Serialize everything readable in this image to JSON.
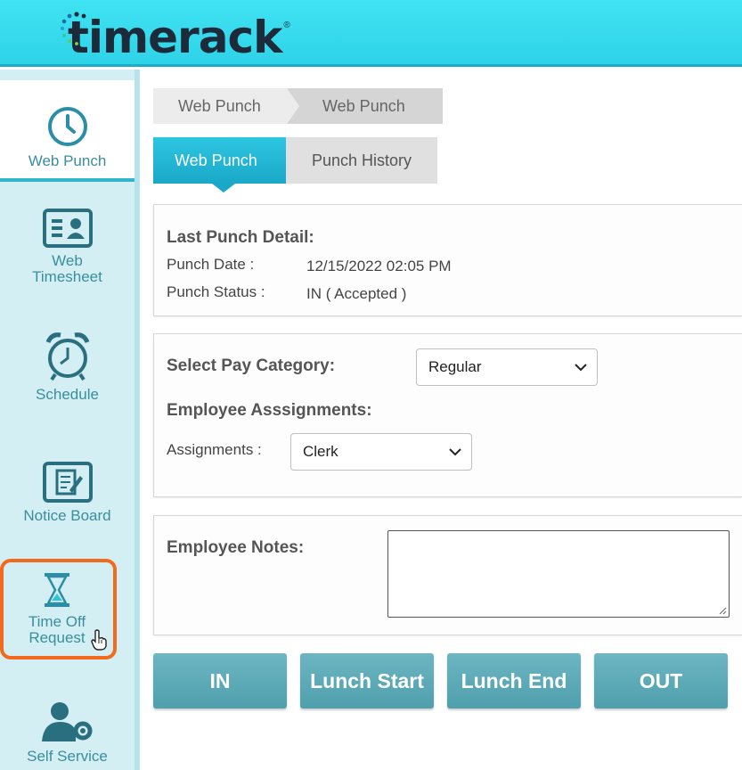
{
  "brand": {
    "name": "timerack",
    "reg": "®"
  },
  "sidebar": {
    "items": [
      {
        "label": "Web Punch",
        "icon": "clock-icon"
      },
      {
        "label_line1": "Web",
        "label_line2": "Timesheet",
        "icon": "timesheet-icon"
      },
      {
        "label": "Schedule",
        "icon": "alarm-clock-icon"
      },
      {
        "label": "Notice Board",
        "icon": "notice-board-icon"
      },
      {
        "label_line1": "Time Off",
        "label_line2": "Request",
        "icon": "hourglass-icon"
      },
      {
        "label": "Self Service",
        "icon": "user-gear-icon"
      }
    ]
  },
  "breadcrumb": {
    "first": "Web Punch",
    "second": "Web Punch"
  },
  "tabs": {
    "web_punch": "Web Punch",
    "punch_history": "Punch History"
  },
  "last_punch": {
    "heading": "Last Punch Detail:",
    "date_label": "Punch Date :",
    "date_value": "12/15/2022 02:05 PM",
    "status_label": "Punch Status :",
    "status_value": "IN ( Accepted )"
  },
  "pay": {
    "heading": "Select Pay Category:",
    "selected": "Regular",
    "assign_heading": "Employee Asssignments:",
    "assign_label": "Assignments :",
    "assign_selected": "Clerk"
  },
  "notes": {
    "heading": "Employee Notes:"
  },
  "buttons": {
    "in": "IN",
    "lunch_start": "Lunch Start",
    "lunch_end": "Lunch End",
    "out": "OUT"
  },
  "colors": {
    "accent": "#2ec6e2",
    "sidebar_text": "#3a8e9e",
    "highlight": "#f26a1b",
    "button": "#5aa8b5"
  }
}
